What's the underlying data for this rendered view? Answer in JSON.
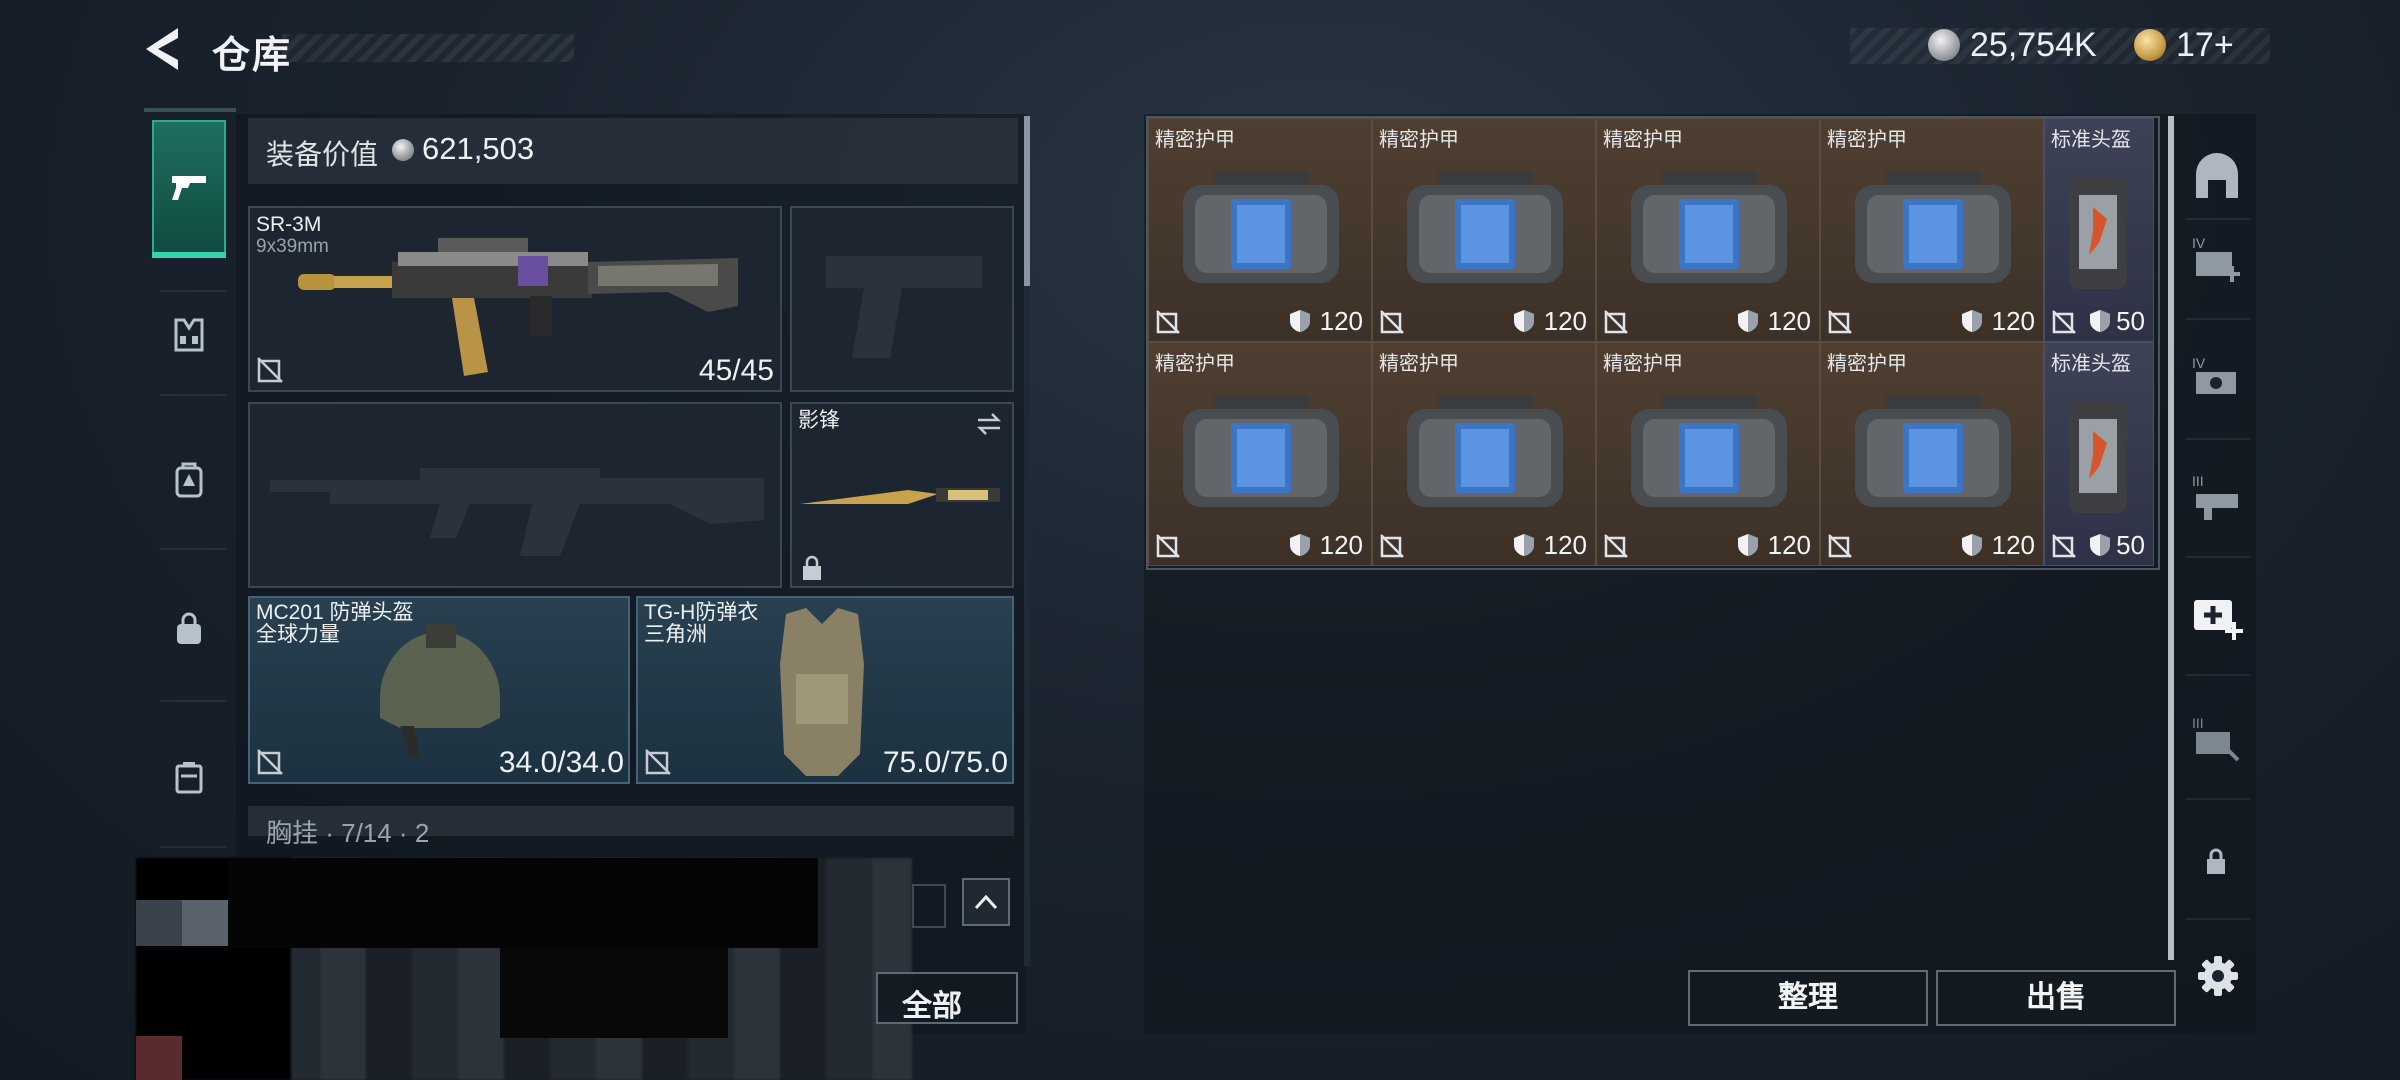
{
  "header": {
    "title": "仓库",
    "currency": {
      "silver": "25,754K",
      "gold": "17+"
    }
  },
  "left_rail": {
    "items": [
      "weapons-icon",
      "chest-rig-icon",
      "backpack-icon",
      "bag-icon",
      "case-icon"
    ],
    "active": "weapons-icon"
  },
  "loadout": {
    "value_label": "装备价值",
    "value": "621,503",
    "primary_weapon": {
      "name": "SR-3M",
      "caliber": "9x39mm",
      "ammo": "45/45"
    },
    "melee": {
      "name": "影锋"
    },
    "helmet": {
      "name": "MC201 防弹头盔",
      "faction": "全球力量",
      "durability": "34.0/34.0"
    },
    "armor": {
      "name": "TG-H防弹衣",
      "faction": "三角洲",
      "durability": "75.0/75.0"
    },
    "chest_rig_partial": "胸挂 · 7/14 · 2",
    "take_all": "全部"
  },
  "storage": {
    "rows": [
      [
        {
          "name": "精密护甲",
          "value": "120",
          "kind": "armor"
        },
        {
          "name": "精密护甲",
          "value": "120",
          "kind": "armor"
        },
        {
          "name": "精密护甲",
          "value": "120",
          "kind": "armor"
        },
        {
          "name": "精密护甲",
          "value": "120",
          "kind": "armor"
        },
        {
          "name": "标准头盔",
          "value": "50",
          "kind": "helmet"
        }
      ],
      [
        {
          "name": "精密护甲",
          "value": "120",
          "kind": "armor"
        },
        {
          "name": "精密护甲",
          "value": "120",
          "kind": "armor"
        },
        {
          "name": "精密护甲",
          "value": "120",
          "kind": "armor"
        },
        {
          "name": "精密护甲",
          "value": "120",
          "kind": "armor"
        },
        {
          "name": "标准头盔",
          "value": "50",
          "kind": "helmet"
        }
      ]
    ],
    "buttons": {
      "sort": "整理",
      "sell": "出售"
    }
  },
  "right_rail": {
    "items": [
      "storage-home-icon",
      "tier-4-add-icon",
      "tier-4-repair-icon",
      "tier-3-crafting-icon",
      "medical-add-icon",
      "tier-3-repair-icon",
      "lock-icon",
      "settings-gear-icon"
    ]
  },
  "colors": {
    "accent_green": "#34d3b0",
    "armor_cell": "#4e3f31",
    "helmet_cell": "#3e4256"
  }
}
